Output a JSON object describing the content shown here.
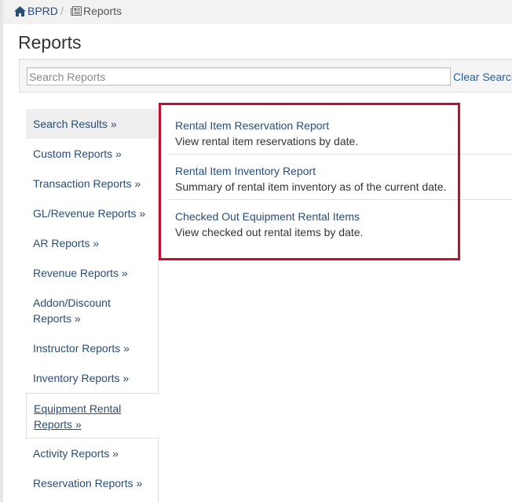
{
  "breadcrumb": {
    "home_icon": "home-icon",
    "home_label": "BPRD",
    "separator": "/",
    "reports_icon": "newspaper-icon",
    "reports_label": "Reports"
  },
  "page": {
    "title": "Reports"
  },
  "search": {
    "placeholder": "Search Reports",
    "value": "",
    "clear_label": "Clear Search"
  },
  "sidebar": {
    "items": [
      {
        "label": "Search Results »"
      },
      {
        "label": "Custom Reports »"
      },
      {
        "label": "Transaction Reports »"
      },
      {
        "label": "GL/Revenue Reports »"
      },
      {
        "label": "AR Reports »"
      },
      {
        "label": "Revenue Reports »"
      },
      {
        "label": "Addon/Discount Reports »"
      },
      {
        "label": "Instructor Reports »"
      },
      {
        "label": "Inventory Reports »"
      },
      {
        "label": "Equipment Rental Reports »"
      },
      {
        "label": "Activity Reports »"
      },
      {
        "label": "Reservation Reports »"
      }
    ]
  },
  "results": [
    {
      "title": "Rental Item Reservation Report",
      "description": "View rental item reservations by date."
    },
    {
      "title": "Rental Item Inventory Report",
      "description": "Summary of rental item inventory as of the current date."
    },
    {
      "title": "Checked Out Equipment Rental Items",
      "description": "View checked out rental items by date."
    }
  ],
  "colors": {
    "link": "#2a4d78",
    "highlight_border": "#c0102e",
    "text": "#333333"
  }
}
